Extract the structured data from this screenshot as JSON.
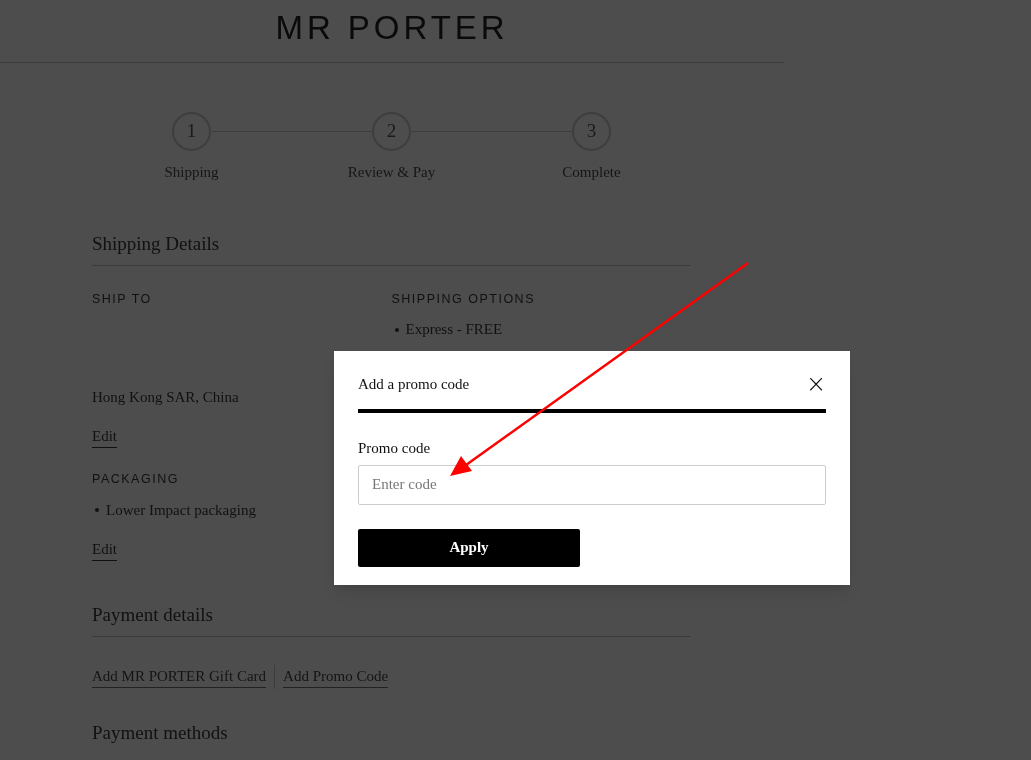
{
  "header": {
    "logo": "MR PORTER"
  },
  "steps": [
    {
      "number": "1",
      "label": "Shipping"
    },
    {
      "number": "2",
      "label": "Review & Pay"
    },
    {
      "number": "3",
      "label": "Complete"
    }
  ],
  "shipping_details": {
    "title": "Shipping Details",
    "ship_to": {
      "heading": "SHIP TO",
      "address": "Hong Kong SAR, China",
      "edit": "Edit"
    },
    "shipping_options": {
      "heading": "SHIPPING OPTIONS",
      "items": [
        "Express - FREE"
      ]
    },
    "packaging": {
      "heading": "PACKAGING",
      "items": [
        "Lower Impact packaging"
      ],
      "edit": "Edit"
    }
  },
  "payment_details": {
    "title": "Payment details",
    "links": [
      "Add MR PORTER Gift Card",
      "Add Promo Code"
    ]
  },
  "payment_methods": {
    "title": "Payment methods"
  },
  "modal": {
    "title": "Add a promo code",
    "close": "×",
    "field_label": "Promo code",
    "placeholder": "Enter code",
    "button": "Apply"
  }
}
